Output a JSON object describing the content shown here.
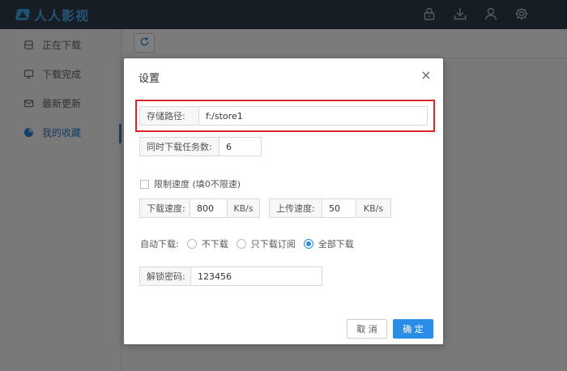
{
  "app": {
    "logo_text": "人人影视"
  },
  "topbar": {
    "icons": [
      "lock-icon",
      "download-icon",
      "user-icon",
      "settings-icon"
    ]
  },
  "sidebar": {
    "items": [
      {
        "label": "正在下载",
        "icon": "download-box-icon"
      },
      {
        "label": "下载完成",
        "icon": "monitor-icon"
      },
      {
        "label": "最新更新",
        "icon": "mail-icon"
      },
      {
        "label": "我的收藏",
        "icon": "pie-chart-icon",
        "active": true
      }
    ]
  },
  "dialog": {
    "title": "设置",
    "close_symbol": "×",
    "storage_path": {
      "label": "存储路径:",
      "value": "f:/store1"
    },
    "concurrent": {
      "label": "同时下载任务数:",
      "value": "6"
    },
    "limit_speed": {
      "label": "限制速度 (填0不限速)",
      "checked": false
    },
    "download_speed": {
      "label": "下载速度:",
      "value": "800",
      "unit": "KB/s"
    },
    "upload_speed": {
      "label": "上传速度:",
      "value": "50",
      "unit": "KB/s"
    },
    "auto_download": {
      "label": "自动下载:",
      "options": [
        {
          "label": "不下载",
          "checked": false
        },
        {
          "label": "只下载订阅",
          "checked": false
        },
        {
          "label": "全部下载",
          "checked": true
        }
      ]
    },
    "unlock_password": {
      "label": "解锁密码:",
      "value": "123456"
    },
    "cancel_label": "取 消",
    "ok_label": "确 定"
  },
  "colors": {
    "accent": "#2b8ee6",
    "highlight": "#d9262b",
    "topbar": "#2f3b4b"
  }
}
